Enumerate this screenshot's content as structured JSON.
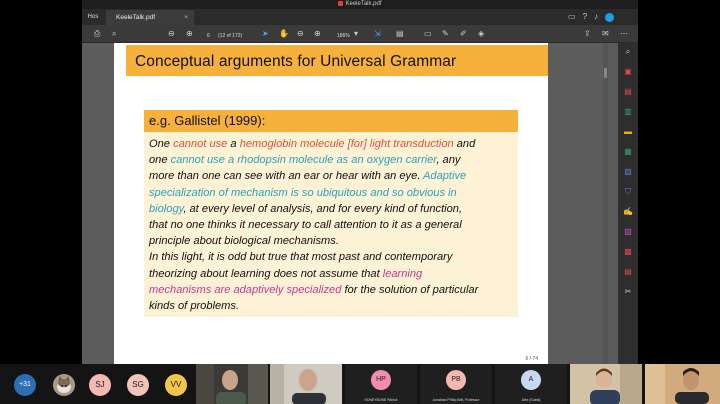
{
  "window": {
    "title": "KeeleTalk.pdf"
  },
  "tabs": {
    "home": "Hos",
    "document": "KeeleTalk.pdf",
    "close": "×"
  },
  "toolbar": {
    "page_current": "6",
    "page_total": "(12 of 172)",
    "zoom": "186%"
  },
  "slide": {
    "frame_title": "Conceptual arguments for Universal Grammar",
    "block_title": "e.g. Gallistel (1999):",
    "lines": [
      [
        {
          "t": "One "
        },
        {
          "t": "cannot use",
          "c": "red"
        },
        {
          "t": " a "
        },
        {
          "t": "hemoglobin molecule [for] light transduction",
          "c": "red"
        },
        {
          "t": " and"
        }
      ],
      [
        {
          "t": "one "
        },
        {
          "t": "cannot use a rhodopsin molecule as an oxygen carrier",
          "c": "cyan"
        },
        {
          "t": ", any"
        }
      ],
      [
        {
          "t": "more than one can see with an ear or hear with an eye. "
        },
        {
          "t": "Adaptive",
          "c": "cyan"
        }
      ],
      [
        {
          "t": "specialization of mechanism is so ubiquitous and so obvious in",
          "c": "cyan"
        }
      ],
      [
        {
          "t": "biology",
          "c": "cyan"
        },
        {
          "t": ", at every level of analysis, and for every kind of function,"
        }
      ],
      [
        {
          "t": "that no one thinks it necessary to call attention to it as a general"
        }
      ],
      [
        {
          "t": "principle about biological mechanisms."
        }
      ],
      [
        {
          "t": "In this light, it is odd but true that most past and contemporary"
        }
      ],
      [
        {
          "t": "theorizing about learning does not assume that "
        },
        {
          "t": "learning",
          "c": "magenta"
        }
      ],
      [
        {
          "t": "mechanisms are adaptively specialized",
          "c": "magenta"
        },
        {
          "t": " for the solution of particular"
        }
      ],
      [
        {
          "t": "kinds of problems."
        }
      ]
    ],
    "page_number": "6 / 74"
  },
  "participants": {
    "more_count": "+31",
    "circles": [
      {
        "initials": "SJ",
        "color": "#f3b8b0"
      },
      {
        "initials": "SG",
        "color": "#f1c4b6"
      },
      {
        "initials": "VV",
        "color": "#f2c54a"
      }
    ],
    "tiles": [
      {
        "initials": "HP",
        "color": "#f28db0",
        "name": "HONEYBONE Patrick"
      },
      {
        "initials": "PB",
        "color": "#f3b8b0",
        "name": "Jonathan Phillip Brill, Professor"
      },
      {
        "initials": "A",
        "color": "#c7d8f0",
        "name": "Alex (Guest)"
      }
    ]
  },
  "colors": {
    "frame": "#f5b13c",
    "block_bg": "#fdf1d6",
    "red": "#d9533a",
    "cyan": "#2aa3b8",
    "magenta": "#c23a93"
  }
}
